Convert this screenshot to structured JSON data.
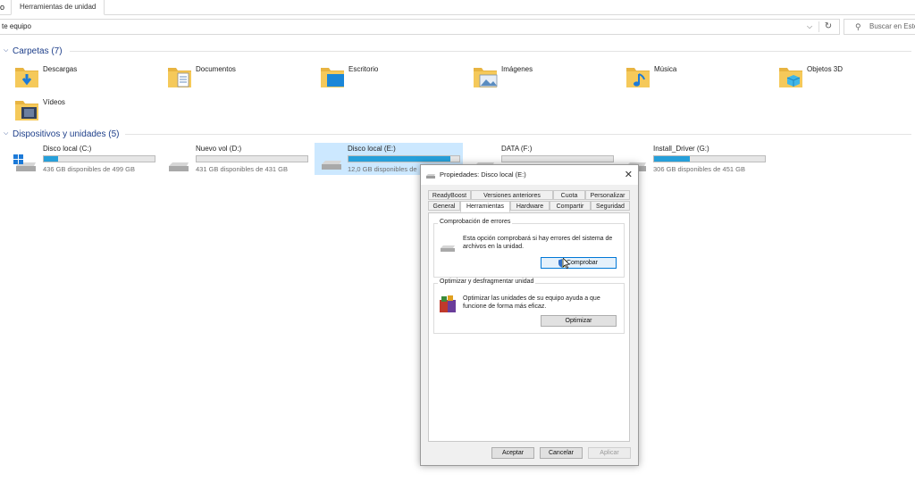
{
  "ribbon": {
    "left_tab": "o",
    "active_tab": "Herramientas de unidad"
  },
  "address": {
    "path": "te equipo",
    "dropdown": "⌵",
    "refresh": "↻"
  },
  "search": {
    "icon": "⚲",
    "placeholder": "Buscar en Este"
  },
  "folders_section": {
    "title": "Carpetas (7)",
    "chevron": "⌵"
  },
  "folders": [
    {
      "name": "Descargas",
      "icon": "downloads-folder-icon"
    },
    {
      "name": "Documentos",
      "icon": "documents-folder-icon"
    },
    {
      "name": "Escritorio",
      "icon": "desktop-folder-icon"
    },
    {
      "name": "Imágenes",
      "icon": "pictures-folder-icon"
    },
    {
      "name": "Música",
      "icon": "music-folder-icon"
    },
    {
      "name": "Objetos 3D",
      "icon": "3d-objects-folder-icon"
    },
    {
      "name": "Vídeos",
      "icon": "videos-folder-icon"
    }
  ],
  "drives_section": {
    "title": "Dispositivos y unidades (5)",
    "chevron": "⌵"
  },
  "drives": [
    {
      "name": "Disco local (C:)",
      "space": "436 GB disponibles de 499 GB",
      "used_fraction": 0.13
    },
    {
      "name": "Nuevo vol (D:)",
      "space": "431 GB disponibles de 431 GB",
      "used_fraction": 0.0
    },
    {
      "name": "Disco local (E:)",
      "space": "12,0 GB disponibles de",
      "used_fraction": 0.92
    },
    {
      "name": "DATA (F:)",
      "space": "",
      "used_fraction": 0.0
    },
    {
      "name": "Install_Driver (G:)",
      "space": "306 GB disponibles de 451 GB",
      "used_fraction": 0.32
    }
  ],
  "dialog": {
    "title": "Propiedades: Disco local (E:)",
    "close": "✕",
    "tabs_top": [
      "ReadyBoost",
      "Versiones anteriores",
      "Cuota",
      "Personalizar"
    ],
    "tabs_bottom": [
      "General",
      "Herramientas",
      "Hardware",
      "Compartir",
      "Seguridad"
    ],
    "error_check": {
      "label": "Comprobación de errores",
      "text": "Esta opción comprobará si hay errores del sistema de archivos en la unidad.",
      "button": "Comprobar"
    },
    "optimize": {
      "label": "Optimizar y desfragmentar unidad",
      "text": "Optimizar las unidades de su equipo ayuda a que funcione de forma más eficaz.",
      "button": "Optimizar"
    },
    "footer": {
      "accept": "Aceptar",
      "cancel": "Cancelar",
      "apply": "Aplicar"
    }
  },
  "colors": {
    "accent": "#0078d7",
    "progress": "#26a0da",
    "header_text": "#1e3f8a",
    "folder": "#f5c95a",
    "selection": "#cce8ff"
  }
}
